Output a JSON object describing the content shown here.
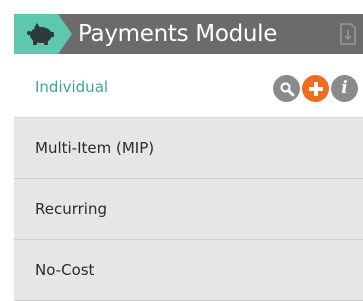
{
  "header": {
    "title": "Payments Module",
    "icon": "piggy-bank-icon",
    "export_icon": "export-icon",
    "accent_color": "#5ec7b0",
    "background_color": "#6b6b6b"
  },
  "menu": {
    "items": [
      {
        "label": "Individual",
        "active": true
      },
      {
        "label": "Multi-Item (MIP)",
        "active": false
      },
      {
        "label": "Recurring",
        "active": false
      },
      {
        "label": "No-Cost",
        "active": false
      }
    ],
    "active_text_color": "#3aa986",
    "item_background": "#e6e6e7"
  },
  "actions": [
    {
      "icon": "search-icon",
      "color": "#8a8a8a"
    },
    {
      "icon": "add-icon",
      "color": "#f26b21"
    },
    {
      "icon": "info-icon",
      "color": "#8a8a8a",
      "glyph": "i"
    }
  ]
}
